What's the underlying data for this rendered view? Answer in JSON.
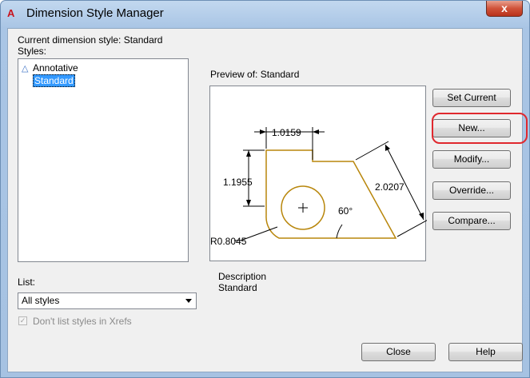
{
  "window": {
    "app_icon": "A",
    "title": "Dimension Style Manager",
    "close_glyph": "x"
  },
  "current_style": {
    "label": "Current dimension style: Standard"
  },
  "styles": {
    "label": "Styles:",
    "items": [
      {
        "label": "Annotative",
        "icon": "annotative-triangle-icon"
      },
      {
        "label": "Standard",
        "selected": true
      }
    ]
  },
  "preview": {
    "label": "Preview of: Standard",
    "dims": {
      "top": "1.0159",
      "left": "1.1955",
      "diagonal": "2.0207",
      "angle": "60°",
      "radius": "R0.8045",
      "center_mark": "+"
    },
    "line_color": "#b8860b"
  },
  "description": {
    "label": "Description",
    "value": "Standard"
  },
  "buttons": {
    "set_current": "Set Current",
    "new": "New...",
    "modify": "Modify...",
    "override": "Override...",
    "compare": "Compare...",
    "close": "Close",
    "help": "Help"
  },
  "list": {
    "label": "List:",
    "selected": "All styles"
  },
  "xrefs": {
    "label": "Don't list styles in Xrefs",
    "checked": true,
    "disabled": true
  },
  "highlight_color": "#e0282e"
}
